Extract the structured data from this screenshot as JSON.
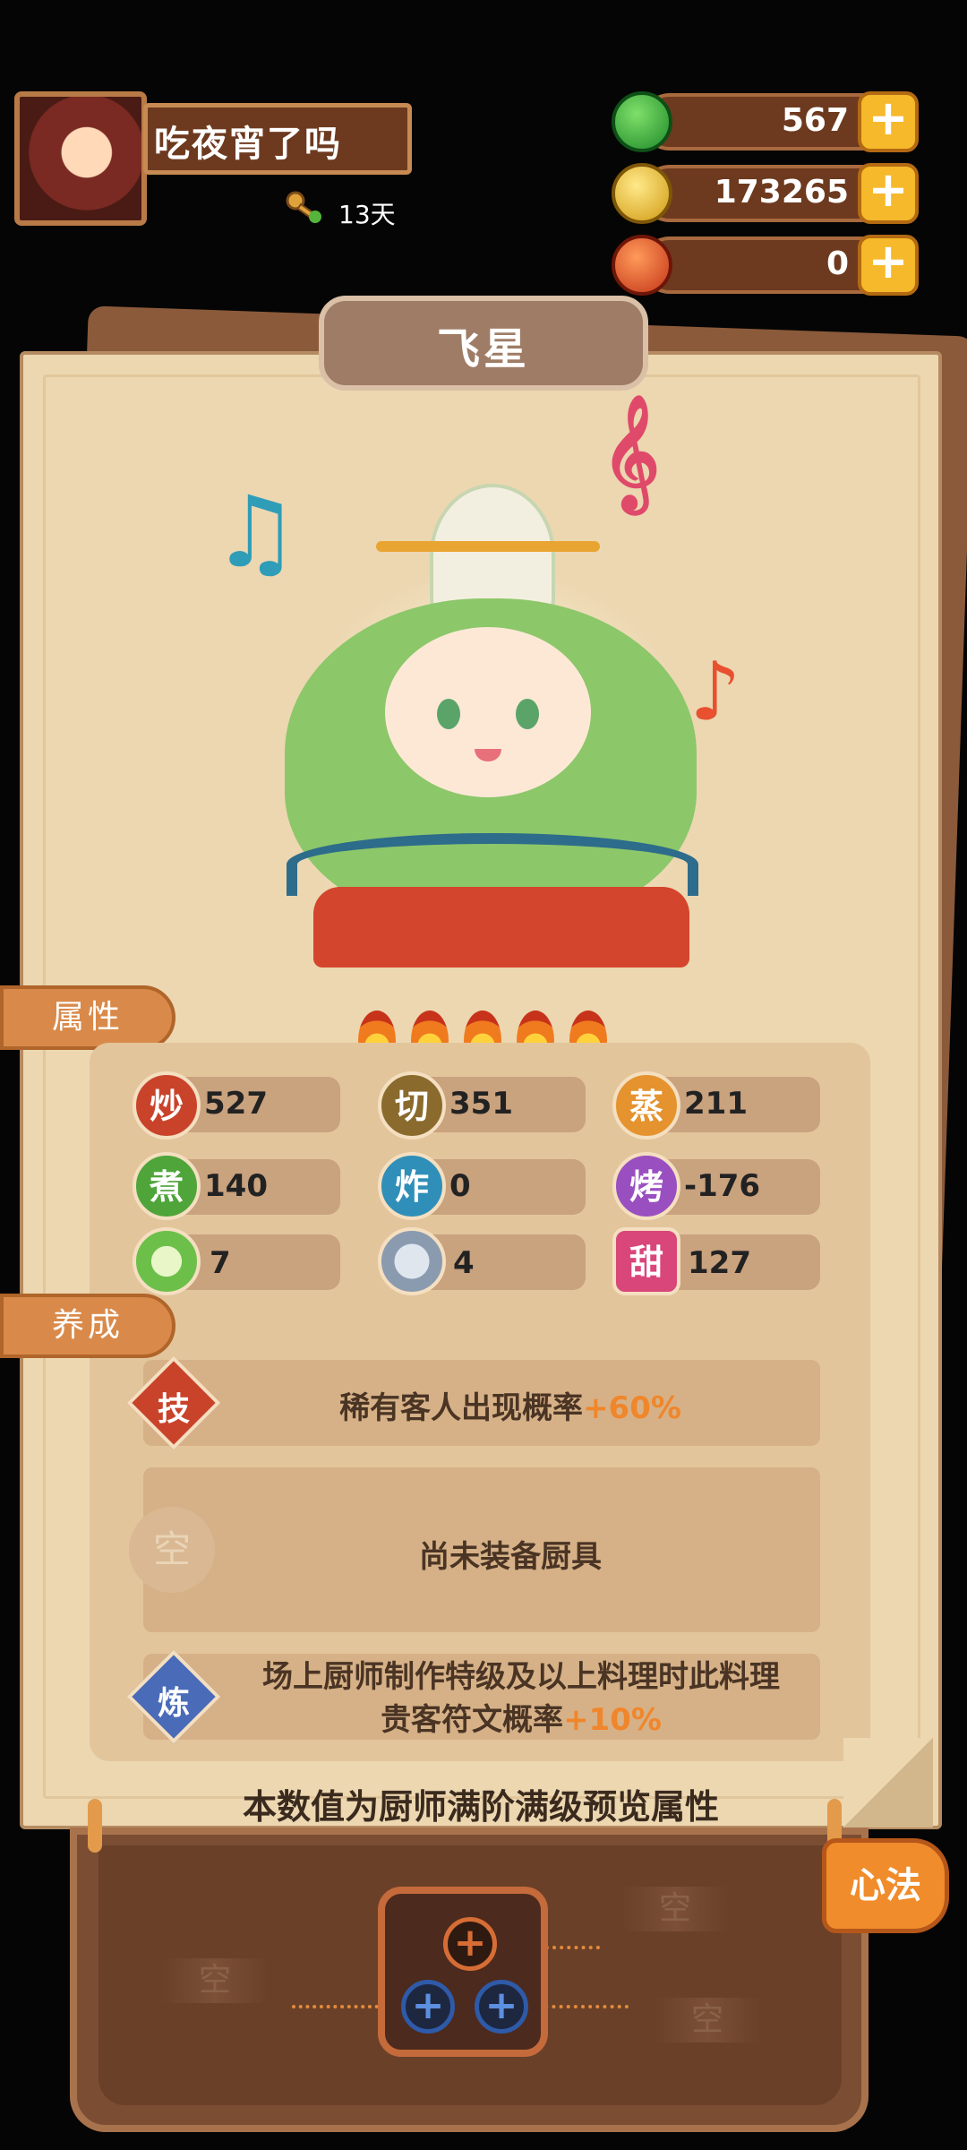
{
  "player": {
    "name": "吃夜宵了吗",
    "days": "13天"
  },
  "resources": [
    {
      "name": "jade",
      "value": "567",
      "color": "#2fa83a"
    },
    {
      "name": "coin",
      "value": "173265",
      "color": "#e8b21b"
    },
    {
      "name": "ruby",
      "value": "0",
      "color": "#d9431e"
    }
  ],
  "chef": {
    "name": "飞星",
    "stars": 5
  },
  "tabs": {
    "attributes": "属性",
    "training": "养成"
  },
  "stats": [
    {
      "label": "炒",
      "value": "527",
      "color": "#c9432b"
    },
    {
      "label": "切",
      "value": "351",
      "color": "#8a6a2d"
    },
    {
      "label": "蒸",
      "value": "211",
      "color": "#e5932f"
    },
    {
      "label": "煮",
      "value": "140",
      "color": "#4fa53a"
    },
    {
      "label": "炸",
      "value": "0",
      "color": "#2f8fb8"
    },
    {
      "label": "烤",
      "value": "-176",
      "color": "#9a4fc0"
    },
    {
      "label": "",
      "value": "7",
      "color": "#6cc04a"
    },
    {
      "label": "",
      "value": "4",
      "color": "#8a9bb0"
    },
    {
      "label": "甜",
      "value": "127",
      "color": "#d9467a"
    }
  ],
  "training": {
    "skill_badge": "技",
    "skill_text": "稀有客人出现概率",
    "skill_bonus": "+60%",
    "empty_badge": "空",
    "equip_text": "尚未装备厨具",
    "refine_badge": "炼",
    "refine_text_1": "场上厨师制作特级及以上料理时此料理",
    "refine_text_2": "贵客符文概率",
    "refine_bonus": "+10%"
  },
  "footer_note": "本数值为厨师满阶满级预览属性",
  "xinfa": {
    "label": "心法",
    "empty_slots": [
      "空",
      "空",
      "空"
    ]
  }
}
